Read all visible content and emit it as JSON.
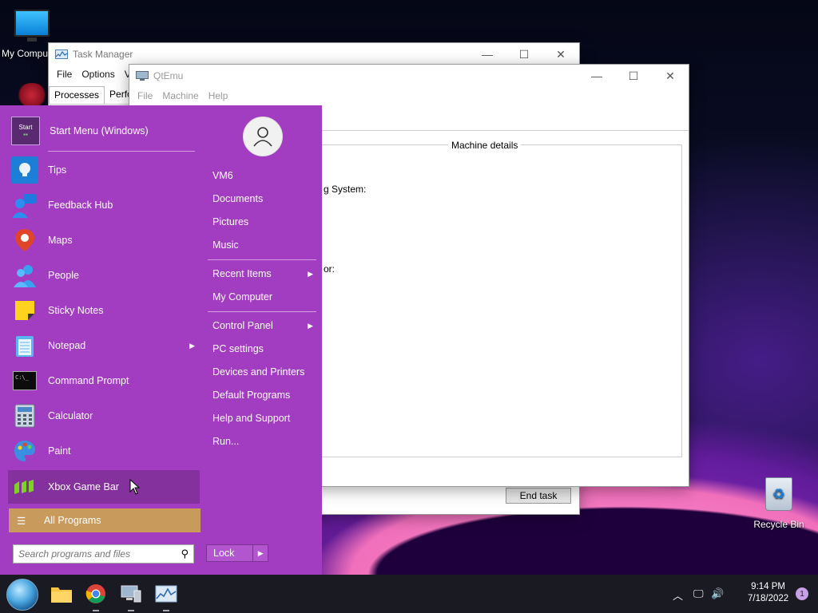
{
  "desktop": {
    "icons": [
      {
        "label": "My Compu",
        "icon": "computer-icon"
      },
      {
        "label": "Recycle Bin",
        "icon": "recycle-bin-icon"
      }
    ]
  },
  "task_manager": {
    "title": "Task Manager",
    "menu": [
      "File",
      "Options",
      "V"
    ],
    "tabs": [
      "Processes",
      "Perfor"
    ],
    "end_task": "End task"
  },
  "qtemu": {
    "title": "QtEmu",
    "menu": [
      "File",
      "Machine",
      "Help"
    ],
    "group_title": "Machine details",
    "label_os": "g System:",
    "label_or": "or:"
  },
  "start_menu": {
    "pinned": [
      {
        "label": "Start Menu (Windows)",
        "icon": "start-menu-icon"
      },
      {
        "label": "Tips",
        "icon": "lightbulb-icon"
      },
      {
        "label": "Feedback Hub",
        "icon": "feedback-hub-icon"
      },
      {
        "label": "Maps",
        "icon": "map-pin-icon"
      },
      {
        "label": "People",
        "icon": "people-icon"
      },
      {
        "label": "Sticky Notes",
        "icon": "sticky-note-icon"
      },
      {
        "label": "Notepad",
        "icon": "notepad-icon"
      },
      {
        "label": "Command Prompt",
        "icon": "terminal-icon"
      },
      {
        "label": "Calculator",
        "icon": "calculator-icon"
      },
      {
        "label": "Paint",
        "icon": "paint-palette-icon"
      },
      {
        "label": "Xbox Game Bar",
        "icon": "xbox-game-bar-icon"
      }
    ],
    "start_icon_text": "Start",
    "all_programs": "All Programs",
    "search_placeholder": "Search programs and files",
    "right": {
      "user": "VM6",
      "items": [
        "Documents",
        "Pictures",
        "Music",
        "Recent Items",
        "My Computer",
        "Control Panel",
        "PC settings",
        "Devices and Printers",
        "Default Programs",
        "Help and Support",
        "Run..."
      ]
    },
    "lock": "Lock"
  },
  "taskbar": {
    "apps": [
      "file-explorer-icon",
      "chrome-icon",
      "qtemu-icon",
      "task-manager-icon"
    ],
    "time": "9:14 PM",
    "date": "7/18/2022",
    "notifications": "1"
  }
}
